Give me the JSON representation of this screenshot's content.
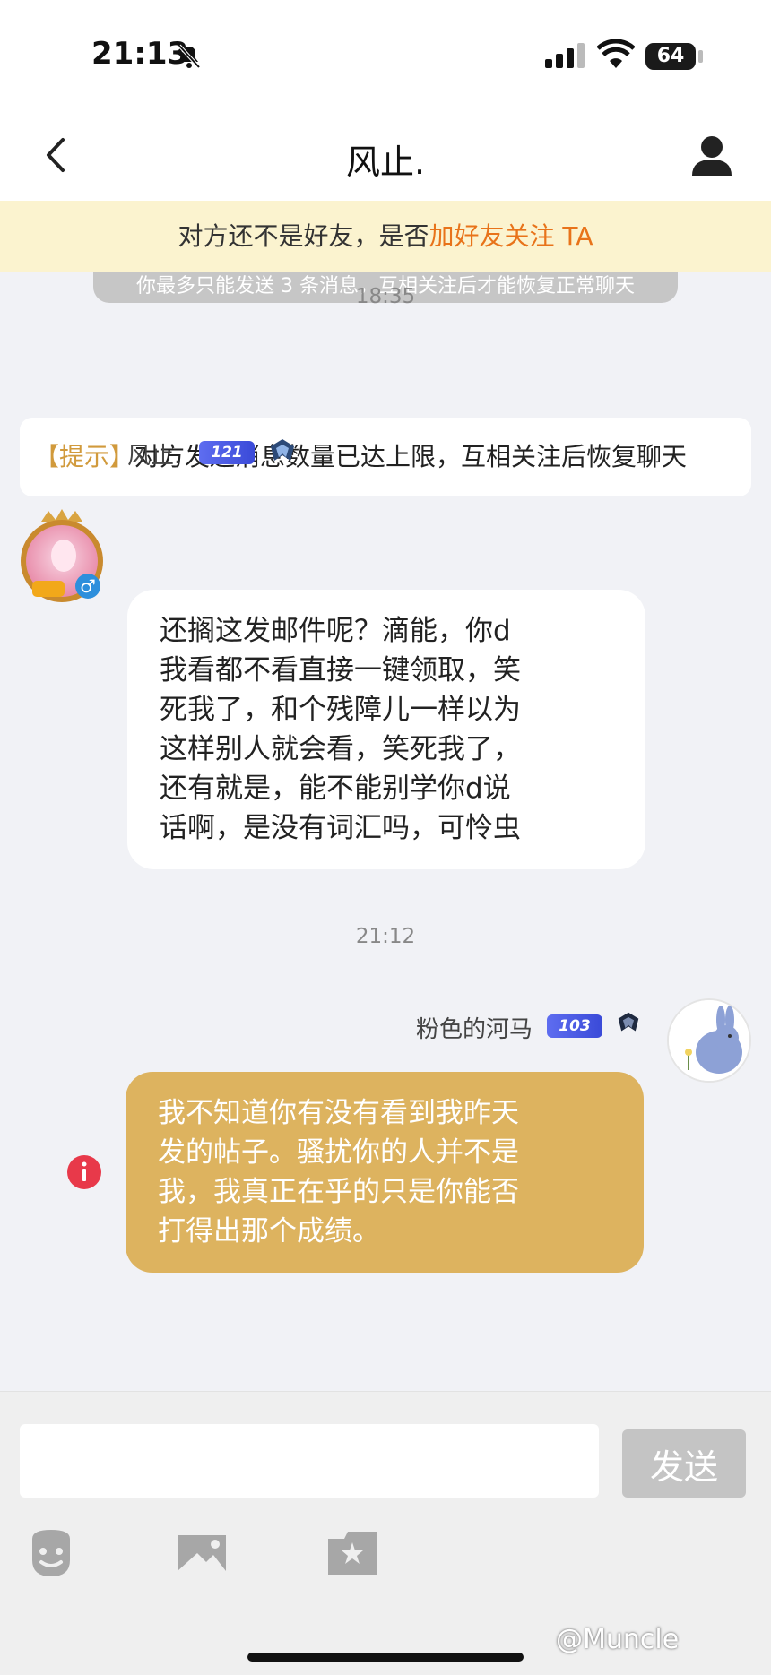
{
  "status_bar": {
    "time": "21:13",
    "battery": "64",
    "icons": [
      "bell-slash-icon",
      "signal-icon",
      "wifi-icon",
      "battery-icon"
    ]
  },
  "nav": {
    "title": "风止.",
    "back_icon": "chevron-left-icon",
    "profile_icon": "person-icon"
  },
  "banner": {
    "text": "对方还不是好友，是否",
    "link": "加好友关注 TA",
    "color": "#e8731a"
  },
  "chat": {
    "limit_notice": "你最多只能发送 3 条消息，互相关注后才能恢复正常聊天",
    "time_1": "18:35",
    "tip": {
      "tag": "【提示】",
      "text": "对方发送消息数量已达上限，互相关注后恢复聊天"
    },
    "incoming": {
      "name": "风止.",
      "level": "121",
      "lines": [
        "还搁这发邮件呢？滴能，你d",
        "我看都不看直接一键领取，笑",
        "死我了，和个残障儿一样以为",
        "这样别人就会看，笑死我了，",
        "还有就是，能不能别学你d说",
        "话啊，是没有词汇吗，可怜虫"
      ]
    },
    "time_2": "21:12",
    "outgoing": {
      "name": "粉色的河马",
      "level": "103",
      "bubble_color": "#ddb35f",
      "lines": [
        "我不知道你有没有看到我昨天",
        "发的帖子。骚扰你的人并不是",
        "我，我真正在乎的只是你能否",
        "打得出那个成绩。"
      ],
      "status_icon": "error-icon"
    }
  },
  "input": {
    "placeholder": "",
    "send_label": "发送",
    "toolbar": [
      "emoji-icon",
      "image-icon",
      "gift-icon"
    ]
  },
  "watermark": "@Muncle"
}
